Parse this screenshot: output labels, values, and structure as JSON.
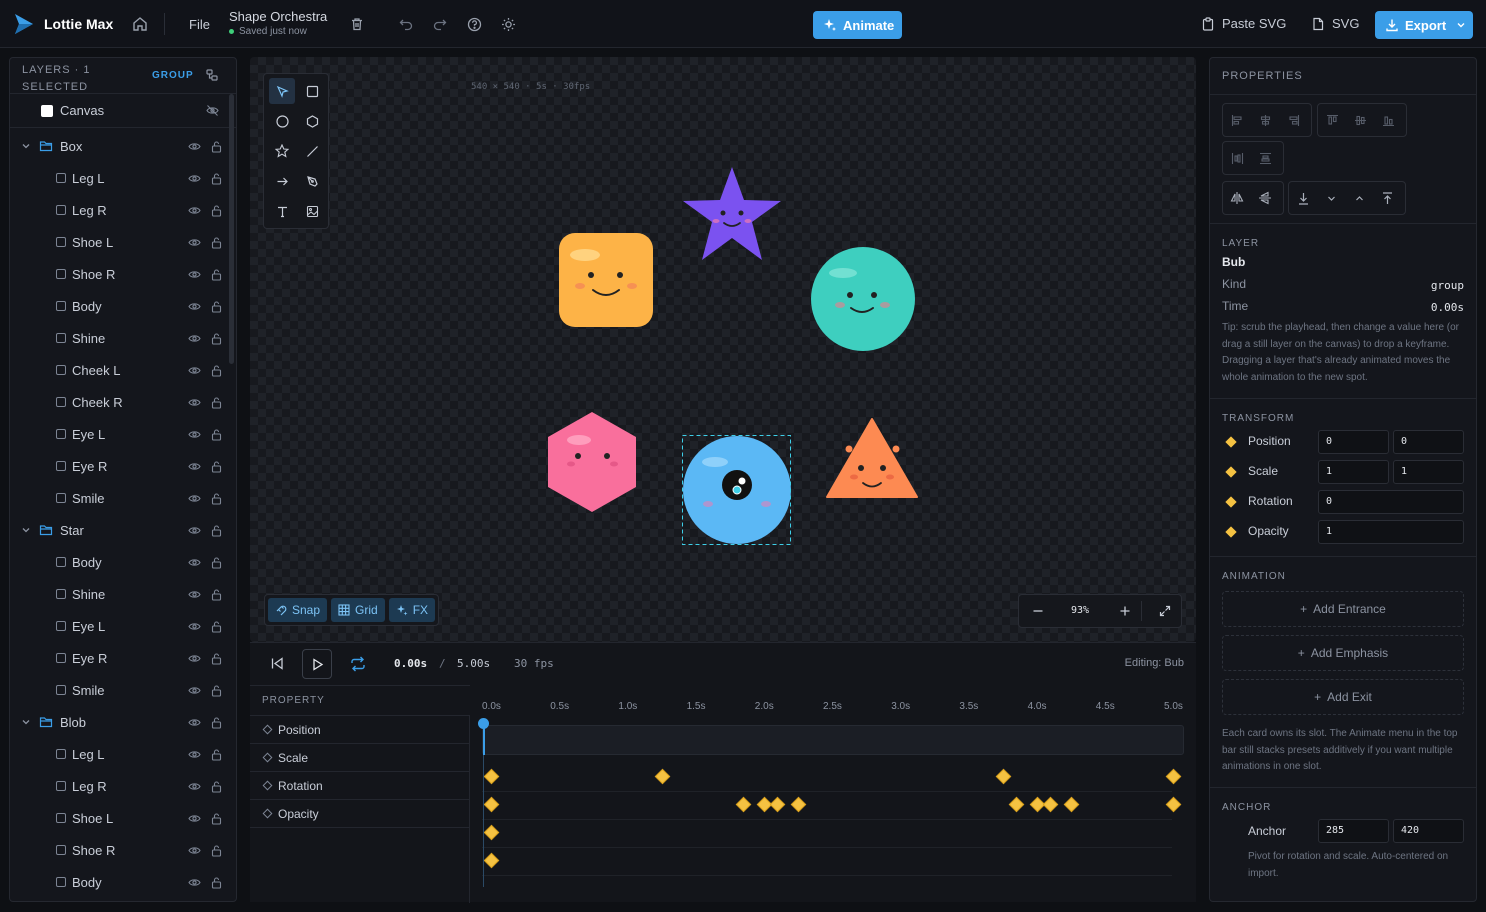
{
  "app": {
    "name": "Lottie Max",
    "file_menu": "File",
    "project_title": "Shape Orchestra",
    "save_status": "Saved just now",
    "animate_label": "Animate",
    "paste_svg_label": "Paste SVG",
    "svg_label": "SVG",
    "export_label": "Export",
    "accent": "#3b9ee8"
  },
  "layers": {
    "header": "LAYERS · 1 SELECTED",
    "group_label": "GROUP",
    "canvas_label": "Canvas",
    "items": [
      {
        "name": "Box",
        "kind": "group"
      },
      {
        "name": "Leg L"
      },
      {
        "name": "Leg R"
      },
      {
        "name": "Shoe L"
      },
      {
        "name": "Shoe R"
      },
      {
        "name": "Body"
      },
      {
        "name": "Shine"
      },
      {
        "name": "Cheek L"
      },
      {
        "name": "Cheek R"
      },
      {
        "name": "Eye L"
      },
      {
        "name": "Eye R"
      },
      {
        "name": "Smile"
      },
      {
        "name": "Star",
        "kind": "group"
      },
      {
        "name": "Body"
      },
      {
        "name": "Shine"
      },
      {
        "name": "Eye L"
      },
      {
        "name": "Eye R"
      },
      {
        "name": "Smile"
      },
      {
        "name": "Blob",
        "kind": "group"
      },
      {
        "name": "Leg L"
      },
      {
        "name": "Leg R"
      },
      {
        "name": "Shoe L"
      },
      {
        "name": "Shoe R"
      },
      {
        "name": "Body"
      }
    ]
  },
  "canvas": {
    "info": "540 × 540 · 5s · 30fps",
    "snap_label": "Snap",
    "grid_label": "Grid",
    "fx_label": "FX",
    "zoom": "93%"
  },
  "timeline": {
    "current_time": "0.00s",
    "separator": "/",
    "duration": "5.00s",
    "fps": "30 fps",
    "editing": "Editing: Bub",
    "property_header": "PROPERTY",
    "properties": [
      "Position",
      "Scale",
      "Rotation",
      "Opacity"
    ],
    "ruler": [
      "0.0s",
      "0.5s",
      "1.0s",
      "1.5s",
      "2.0s",
      "2.5s",
      "3.0s",
      "3.5s",
      "4.0s",
      "4.5s",
      "5.0s"
    ],
    "keyframes": [
      [
        0.0,
        1.25,
        3.75,
        5.0
      ],
      [
        0.0,
        1.85,
        2.0,
        2.1,
        2.25,
        3.85,
        4.0,
        4.1,
        4.25,
        5.0
      ],
      [
        0.0
      ],
      [
        0.0
      ]
    ]
  },
  "properties": {
    "title": "PROPERTIES",
    "layer_section": "LAYER",
    "layer_name": "Bub",
    "kind_label": "Kind",
    "kind_value": "group",
    "time_label": "Time",
    "time_value": "0.00s",
    "tip": "Tip: scrub the playhead, then change a value here (or drag a still layer on the canvas) to drop a keyframe. Dragging a layer that's already animated moves the whole animation to the new spot.",
    "transform_section": "TRANSFORM",
    "transform": [
      {
        "label": "Position",
        "values": [
          "0",
          "0"
        ]
      },
      {
        "label": "Scale",
        "values": [
          "1",
          "1"
        ]
      },
      {
        "label": "Rotation",
        "values": [
          "0"
        ]
      },
      {
        "label": "Opacity",
        "values": [
          "1"
        ]
      }
    ],
    "animation_section": "ANIMATION",
    "add_entrance": "Add Entrance",
    "add_emphasis": "Add Emphasis",
    "add_exit": "Add Exit",
    "animation_note": "Each card owns its slot. The Animate menu in the top bar still stacks presets additively if you want multiple animations in one slot.",
    "anchor_section": "ANCHOR",
    "anchor_label": "Anchor",
    "anchor_x": "285",
    "anchor_y": "420",
    "anchor_note": "Pivot for rotation and scale. Auto-centered on import."
  },
  "shapes": {
    "box_color": "#fdb347",
    "star_color": "#7b52f0",
    "blob_color": "#3ecfbf",
    "hexagon_color": "#f96f9c",
    "bub_color": "#5bb8f5",
    "triangle_color": "#fd8a52"
  }
}
